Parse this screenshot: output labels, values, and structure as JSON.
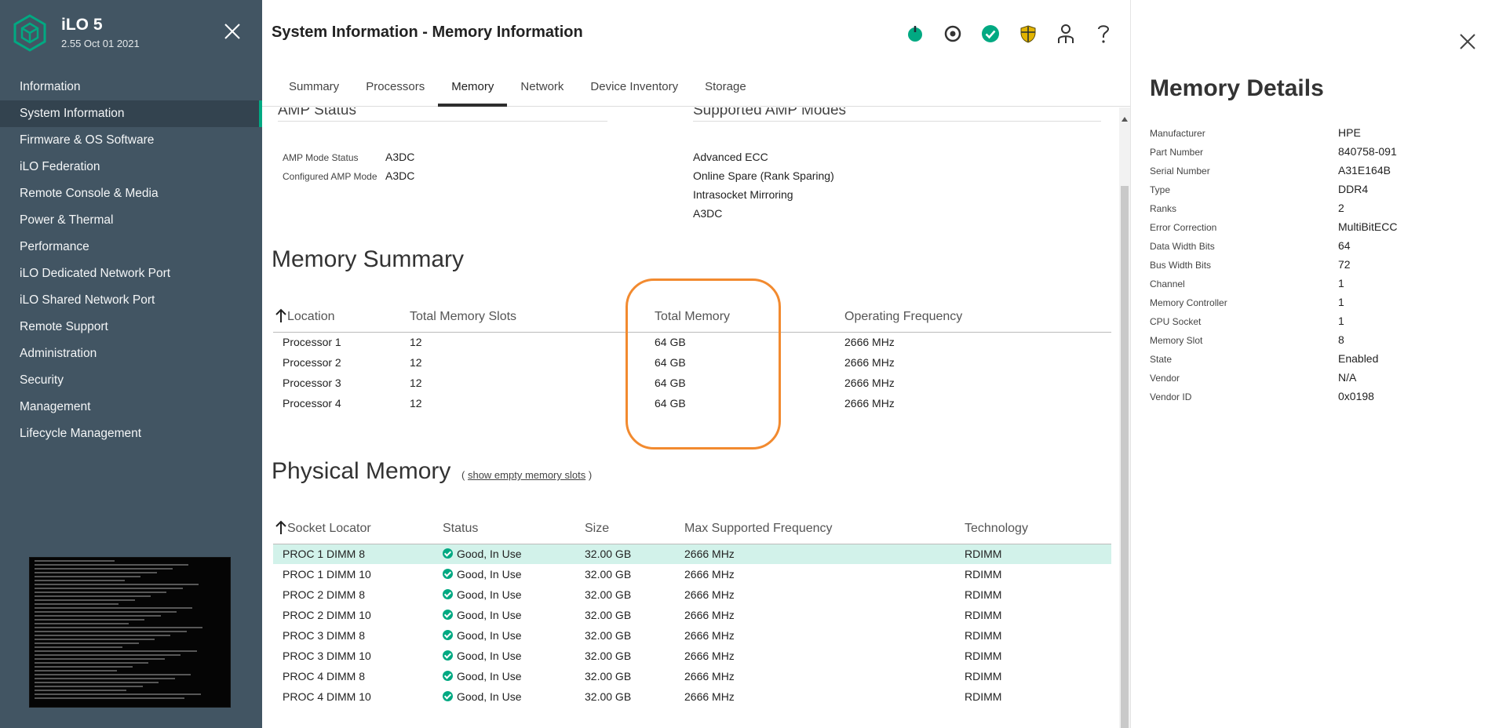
{
  "brand": {
    "title": "iLO 5",
    "version": "2.55 Oct 01 2021"
  },
  "sidebar": {
    "items": [
      {
        "label": "Information"
      },
      {
        "label": "System Information"
      },
      {
        "label": "Firmware & OS Software"
      },
      {
        "label": "iLO Federation"
      },
      {
        "label": "Remote Console & Media"
      },
      {
        "label": "Power & Thermal"
      },
      {
        "label": "Performance"
      },
      {
        "label": "iLO Dedicated Network Port"
      },
      {
        "label": "iLO Shared Network Port"
      },
      {
        "label": "Remote Support"
      },
      {
        "label": "Administration"
      },
      {
        "label": "Security"
      },
      {
        "label": "Management"
      },
      {
        "label": "Lifecycle Management"
      }
    ],
    "active_index": 1
  },
  "header": {
    "title": "System Information - Memory Information",
    "icons": [
      "power-icon",
      "locator-icon",
      "health-ok-icon",
      "security-shield-icon",
      "user-icon",
      "help-icon"
    ],
    "colors": {
      "accent": "#01a982",
      "shield": "#e2b400"
    }
  },
  "tabs": [
    {
      "label": "Summary"
    },
    {
      "label": "Processors"
    },
    {
      "label": "Memory"
    },
    {
      "label": "Network"
    },
    {
      "label": "Device Inventory"
    },
    {
      "label": "Storage"
    }
  ],
  "active_tab": "Memory",
  "amp": {
    "status_heading": "AMP Status",
    "modes_heading": "Supported AMP Modes",
    "mode_status_label": "AMP Mode Status",
    "mode_status_value": "A3DC",
    "configured_label": "Configured AMP Mode",
    "configured_value": "A3DC",
    "supported_modes": [
      "Advanced ECC",
      "Online Spare (Rank Sparing)",
      "Intrasocket Mirroring",
      "A3DC"
    ]
  },
  "memory_summary": {
    "heading": "Memory Summary",
    "columns": [
      "Location",
      "Total Memory Slots",
      "Total Memory",
      "Operating Frequency"
    ],
    "rows": [
      [
        "Processor 1",
        "12",
        "64 GB",
        "2666 MHz"
      ],
      [
        "Processor 2",
        "12",
        "64 GB",
        "2666 MHz"
      ],
      [
        "Processor 3",
        "12",
        "64 GB",
        "2666 MHz"
      ],
      [
        "Processor 4",
        "12",
        "64 GB",
        "2666 MHz"
      ]
    ],
    "highlight_color": "#f28a2f"
  },
  "physical_memory": {
    "heading": "Physical Memory",
    "show_empty_prefix": "(",
    "show_empty_link": "show empty memory slots",
    "show_empty_suffix": ")",
    "columns": [
      "Socket Locator",
      "Status",
      "Size",
      "Max Supported Frequency",
      "Technology"
    ],
    "rows": [
      [
        "PROC 1 DIMM 8",
        "Good, In Use",
        "32.00 GB",
        "2666 MHz",
        "RDIMM"
      ],
      [
        "PROC 1 DIMM 10",
        "Good, In Use",
        "32.00 GB",
        "2666 MHz",
        "RDIMM"
      ],
      [
        "PROC 2 DIMM 8",
        "Good, In Use",
        "32.00 GB",
        "2666 MHz",
        "RDIMM"
      ],
      [
        "PROC 2 DIMM 10",
        "Good, In Use",
        "32.00 GB",
        "2666 MHz",
        "RDIMM"
      ],
      [
        "PROC 3 DIMM 8",
        "Good, In Use",
        "32.00 GB",
        "2666 MHz",
        "RDIMM"
      ],
      [
        "PROC 3 DIMM 10",
        "Good, In Use",
        "32.00 GB",
        "2666 MHz",
        "RDIMM"
      ],
      [
        "PROC 4 DIMM 8",
        "Good, In Use",
        "32.00 GB",
        "2666 MHz",
        "RDIMM"
      ],
      [
        "PROC 4 DIMM 10",
        "Good, In Use",
        "32.00 GB",
        "2666 MHz",
        "RDIMM"
      ]
    ],
    "selected_index": 0,
    "selected_color": "#d2f2ea"
  },
  "details": {
    "title": "Memory Details",
    "rows": [
      [
        "Manufacturer",
        "HPE"
      ],
      [
        "Part Number",
        "840758-091"
      ],
      [
        "Serial Number",
        "A31E164B"
      ],
      [
        "Type",
        "DDR4"
      ],
      [
        "Ranks",
        "2"
      ],
      [
        "Error Correction",
        "MultiBitECC"
      ],
      [
        "Data Width Bits",
        "64"
      ],
      [
        "Bus Width Bits",
        "72"
      ],
      [
        "Channel",
        "1"
      ],
      [
        "Memory Controller",
        "1"
      ],
      [
        "CPU Socket",
        "1"
      ],
      [
        "Memory Slot",
        "8"
      ],
      [
        "State",
        "Enabled"
      ],
      [
        "Vendor",
        "N/A"
      ],
      [
        "Vendor ID",
        "0x0198"
      ]
    ]
  }
}
